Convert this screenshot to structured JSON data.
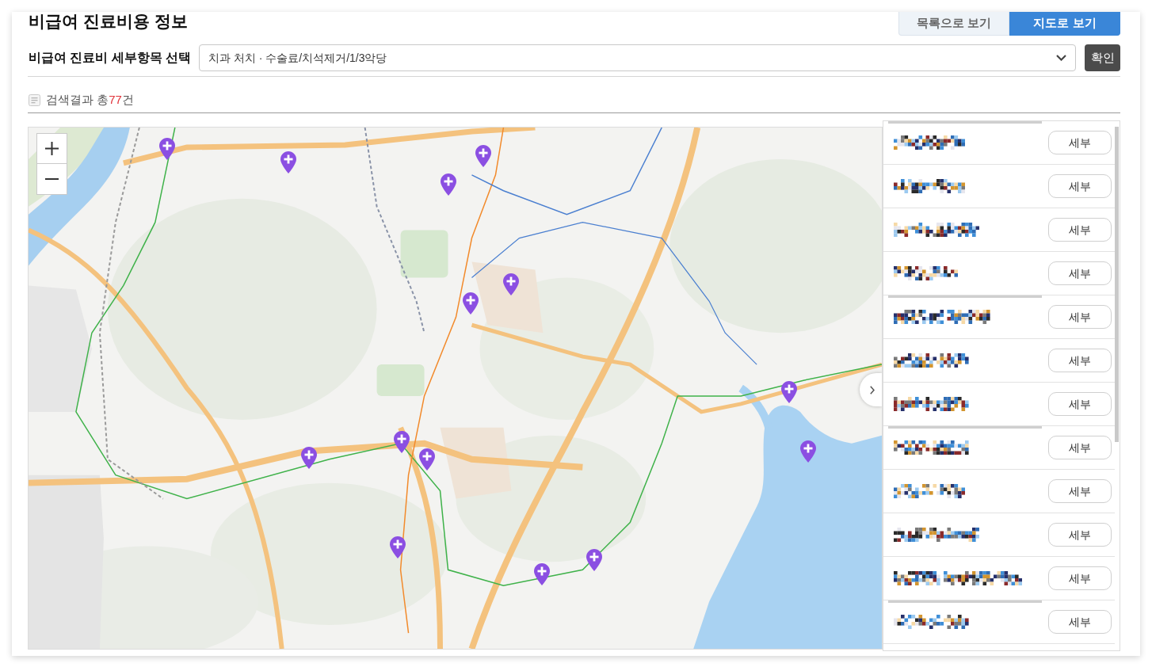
{
  "page": {
    "title": "비급여 진료비용 정보"
  },
  "view_tabs": [
    {
      "label": "목록으로 보기",
      "selected": false
    },
    {
      "label": "지도로 보기",
      "selected": true
    }
  ],
  "filter": {
    "label": "비급여 진료비 세부항목 선택",
    "value": "치과 처치 · 수술료/치석제거/1/3악당",
    "confirm_button": "확인"
  },
  "result": {
    "prefix": "검색결과 총",
    "count": "77",
    "suffix": "건"
  },
  "hospitals": [
    {
      "detail_button": "세부"
    },
    {
      "detail_button": "세부"
    },
    {
      "detail_button": "세부"
    },
    {
      "detail_button": "세부"
    },
    {
      "detail_button": "세부"
    },
    {
      "detail_button": "세부"
    },
    {
      "detail_button": "세부"
    },
    {
      "detail_button": "세부"
    },
    {
      "detail_button": "세부"
    },
    {
      "detail_button": "세부"
    },
    {
      "detail_button": "세부"
    },
    {
      "detail_button": "세부"
    }
  ]
}
